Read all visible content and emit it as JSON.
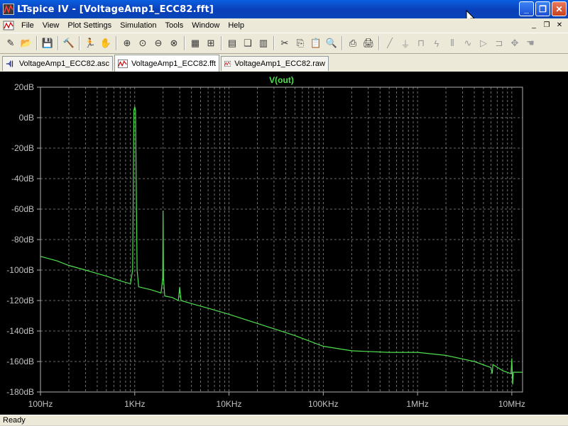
{
  "window": {
    "title": "LTspice IV - [VoltageAmp1_ECC82.fft]",
    "minimize_label": "_",
    "maximize_label": "❐",
    "close_label": "✕"
  },
  "menu": {
    "items": [
      "File",
      "View",
      "Plot Settings",
      "Simulation",
      "Tools",
      "Window",
      "Help"
    ],
    "mdi_minimize": "_",
    "mdi_restore": "❐",
    "mdi_close": "✕"
  },
  "toolbar": {
    "buttons": [
      {
        "icon": "new-schematic-icon",
        "glyph": "✎"
      },
      {
        "icon": "open-icon",
        "glyph": "📂"
      },
      {
        "icon": "save-icon",
        "glyph": "💾"
      },
      {
        "icon": "control-panel-icon",
        "glyph": "🔨"
      },
      {
        "icon": "run-icon",
        "glyph": "🏃"
      },
      {
        "icon": "halt-icon",
        "glyph": "✋"
      },
      {
        "icon": "zoom-in-icon",
        "glyph": "⊕"
      },
      {
        "icon": "zoom-pan-icon",
        "glyph": "⊙"
      },
      {
        "icon": "zoom-out-icon",
        "glyph": "⊖"
      },
      {
        "icon": "zoom-cancel-icon",
        "glyph": "⊗"
      },
      {
        "icon": "autorange-icon",
        "glyph": "▦"
      },
      {
        "icon": "zoom-fit-icon",
        "glyph": "⊞"
      },
      {
        "icon": "tile-horizontal-icon",
        "glyph": "▤"
      },
      {
        "icon": "cascade-icon",
        "glyph": "❏"
      },
      {
        "icon": "tile-vertical-icon",
        "glyph": "▥"
      },
      {
        "icon": "cut-icon",
        "glyph": "✂"
      },
      {
        "icon": "copy-icon",
        "glyph": "⎘"
      },
      {
        "icon": "paste-icon",
        "glyph": "📋"
      },
      {
        "icon": "find-icon",
        "glyph": "🔍"
      },
      {
        "icon": "print-preview-icon",
        "glyph": "⎙"
      },
      {
        "icon": "print-icon",
        "glyph": "🖨"
      },
      {
        "icon": "wire-icon",
        "glyph": "╱"
      },
      {
        "icon": "ground-icon",
        "glyph": "⏚"
      },
      {
        "icon": "label-net-icon",
        "glyph": "⊓"
      },
      {
        "icon": "resistor-icon",
        "glyph": "ϟ"
      },
      {
        "icon": "capacitor-icon",
        "glyph": "⫴"
      },
      {
        "icon": "inductor-icon",
        "glyph": "∿"
      },
      {
        "icon": "diode-icon",
        "glyph": "▷"
      },
      {
        "icon": "component-icon",
        "glyph": "⊐"
      },
      {
        "icon": "move-icon",
        "glyph": "✥"
      },
      {
        "icon": "drag-icon",
        "glyph": "☚"
      }
    ]
  },
  "tabs": [
    {
      "label": "VoltageAmp1_ECC82.asc",
      "icon": "schematic-icon",
      "active": false
    },
    {
      "label": "VoltageAmp1_ECC82.fft",
      "icon": "waveform-icon",
      "active": true
    },
    {
      "label": "VoltageAmp1_ECC82.raw",
      "icon": "waveform-icon",
      "active": false
    }
  ],
  "status": {
    "text": "Ready"
  },
  "colors": {
    "trace": "#4fe04f",
    "grid": "#8a8a8a",
    "axis_text": "#c0c0c0",
    "plot_bg": "#000000"
  },
  "chart_data": {
    "type": "line",
    "title": "V(out)",
    "xscale": "log",
    "xlim": [
      100,
      13000000
    ],
    "ylim": [
      -180,
      20
    ],
    "x_ticks": [
      {
        "value": 100,
        "label": "100Hz"
      },
      {
        "value": 1000,
        "label": "1KHz"
      },
      {
        "value": 10000,
        "label": "10KHz"
      },
      {
        "value": 100000,
        "label": "100KHz"
      },
      {
        "value": 1000000,
        "label": "1MHz"
      },
      {
        "value": 10000000,
        "label": "10MHz"
      }
    ],
    "y_ticks": [
      {
        "value": 20,
        "label": "20dB"
      },
      {
        "value": 0,
        "label": "0dB"
      },
      {
        "value": -20,
        "label": "-20dB"
      },
      {
        "value": -40,
        "label": "-40dB"
      },
      {
        "value": -60,
        "label": "-60dB"
      },
      {
        "value": -80,
        "label": "-80dB"
      },
      {
        "value": -100,
        "label": "-100dB"
      },
      {
        "value": -120,
        "label": "-120dB"
      },
      {
        "value": -140,
        "label": "-140dB"
      },
      {
        "value": -160,
        "label": "-160dB"
      },
      {
        "value": -180,
        "label": "-180dB"
      }
    ],
    "grid": true,
    "series": [
      {
        "points": [
          [
            100,
            -91
          ],
          [
            150,
            -94
          ],
          [
            200,
            -97
          ],
          [
            300,
            -100
          ],
          [
            500,
            -104
          ],
          [
            700,
            -107
          ],
          [
            900,
            -109
          ],
          [
            950,
            -100
          ],
          [
            980,
            5
          ],
          [
            1000,
            7
          ],
          [
            1020,
            5
          ],
          [
            1060,
            -100
          ],
          [
            1100,
            -111
          ],
          [
            1500,
            -113
          ],
          [
            1900,
            -115
          ],
          [
            1980,
            -105
          ],
          [
            2000,
            -61
          ],
          [
            2020,
            -105
          ],
          [
            2080,
            -117
          ],
          [
            2500,
            -118
          ],
          [
            2900,
            -120
          ],
          [
            3000,
            -111
          ],
          [
            3100,
            -120
          ],
          [
            4000,
            -122
          ],
          [
            6000,
            -125
          ],
          [
            10000,
            -129
          ],
          [
            20000,
            -135
          ],
          [
            50000,
            -143
          ],
          [
            100000,
            -150
          ],
          [
            200000,
            -153
          ],
          [
            500000,
            -154
          ],
          [
            1000000,
            -154
          ],
          [
            2000000,
            -156
          ],
          [
            4000000,
            -160
          ],
          [
            6000000,
            -164
          ],
          [
            6200000,
            -168
          ],
          [
            6300000,
            -162
          ],
          [
            8000000,
            -166
          ],
          [
            9800000,
            -168
          ],
          [
            10000000,
            -158
          ],
          [
            10200000,
            -175
          ],
          [
            10400000,
            -167
          ],
          [
            13000000,
            -167
          ]
        ]
      }
    ]
  }
}
